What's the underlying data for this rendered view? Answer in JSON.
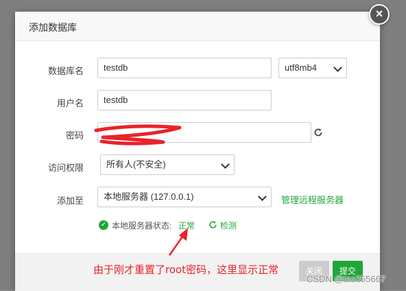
{
  "dialog": {
    "title": "添加数据库",
    "close_label": "×"
  },
  "form": {
    "db_name_label": "数据库名",
    "db_name_value": "testdb",
    "charset_value": "utf8mb4",
    "username_label": "用户名",
    "username_value": "testdb",
    "password_label": "密码",
    "access_label": "访问权限",
    "access_value": "所有人(不安全)",
    "addto_label": "添加至",
    "addto_value": "本地服务器 (127.0.0.1)",
    "manage_remote_link": "管理远程服务器"
  },
  "status": {
    "label": "本地服务器状态:",
    "value": "正常",
    "detect_link": "检测"
  },
  "footer": {
    "close_button": "关闭",
    "submit_button": "提交"
  },
  "annotation": {
    "text": "由于刚才重置了root密码，这里显示正常"
  },
  "watermark": {
    "text": "CSDN @tao355667"
  },
  "colors": {
    "accent": "#20a53a",
    "annotation": "#e8232a",
    "redaction": "#e8232a"
  }
}
